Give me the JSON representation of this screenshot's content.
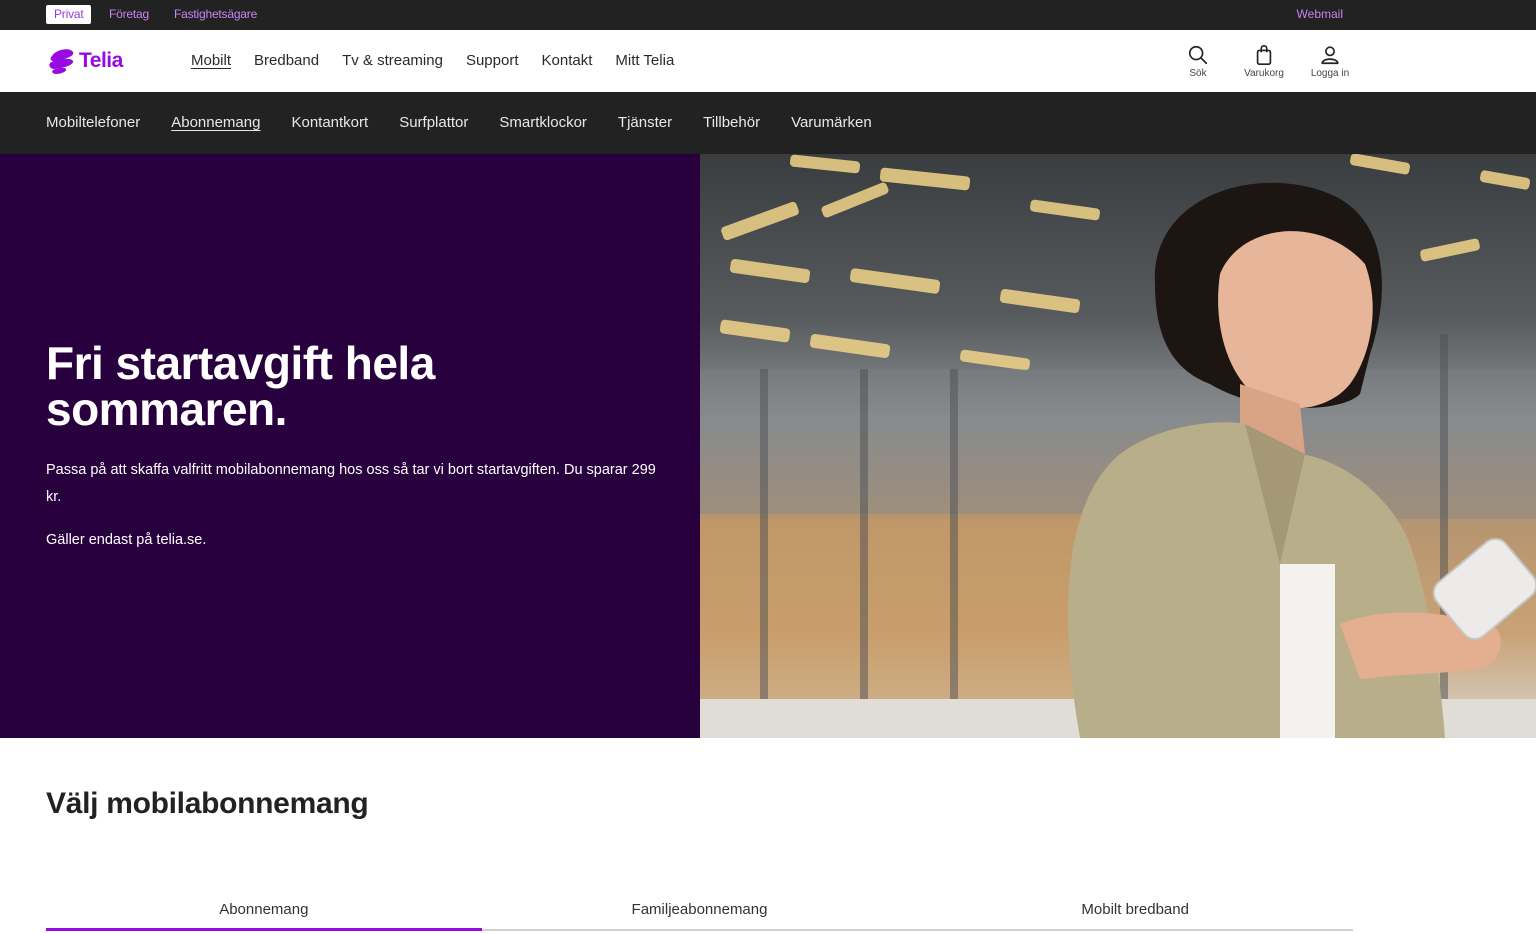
{
  "topbar": {
    "segments": [
      "Privat",
      "Företag",
      "Fastighetsägare"
    ],
    "webmail": "Webmail"
  },
  "brand": {
    "name": "Telia",
    "color": "#990ae3"
  },
  "mainnav": [
    "Mobilt",
    "Bredband",
    "Tv & streaming",
    "Support",
    "Kontakt",
    "Mitt Telia"
  ],
  "tools": {
    "search": "Sök",
    "cart": "Varukorg",
    "login": "Logga in"
  },
  "subnav": [
    "Mobiltelefoner",
    "Abonnemang",
    "Kontantkort",
    "Surfplattor",
    "Smartklockor",
    "Tjänster",
    "Tillbehör",
    "Varumärken"
  ],
  "hero": {
    "title": "Fri startavgift hela sommaren.",
    "body": "Passa på att skaffa valfritt mobilabonnemang hos oss så tar vi bort startavgiften. Du spa­rar 299 kr.",
    "note": "Gäller endast på telia.se.",
    "background": "#29003e"
  },
  "section": {
    "title": "Välj mobilabonnemang",
    "tabs": [
      "Abonnemang",
      "Familjeabonnemang",
      "Mobilt bredband"
    ]
  }
}
